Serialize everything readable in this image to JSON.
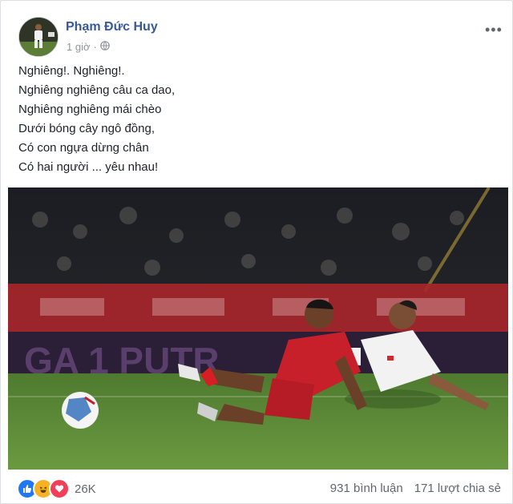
{
  "post": {
    "author": "Phạm Đức Huy",
    "time": "1 giờ",
    "separator": "·",
    "more_label": "•••",
    "lines": [
      "Nghiêng!. Nghiêng!.",
      "Nghiêng nghiêng câu ca dao,",
      "Nghiêng nghiêng mái chèo",
      "Dưới bóng cây ngô đồng,",
      "Có con ngựa dừng chân",
      "Có hai người ... yêu nhau!"
    ],
    "photo_banner_text": "GA 1 PUTR",
    "reactions": {
      "icons": [
        "like-icon",
        "haha-icon",
        "love-icon"
      ],
      "count": "26K"
    },
    "comments": "931 bình luận",
    "shares": "171 lượt chia sẻ"
  },
  "colors": {
    "author": "#385898",
    "secondary": "#90949c",
    "like": "#2078f4",
    "haha": "#f7b125",
    "love": "#f33e58",
    "pitch": "#5d8a3a",
    "red_kit": "#c8202a"
  }
}
